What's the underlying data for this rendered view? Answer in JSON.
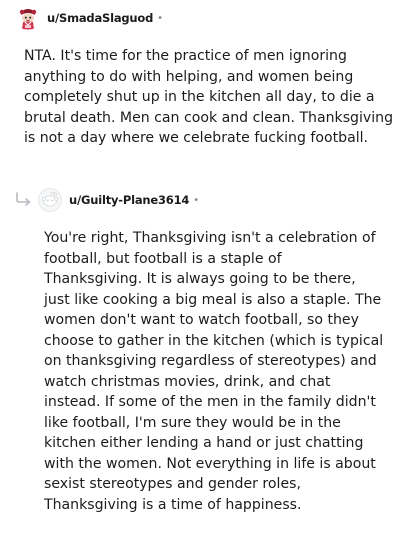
{
  "comments": [
    {
      "username": "u/SmadaSlaguod",
      "avatar_icon": "snoo-avatar-costume-icon",
      "separator": "•",
      "body": "NTA. It's time for the practice of men ignoring anything to do with helping, and women being completely shut up in the kitchen all day, to die a brutal death. Men can cook and clean. Thanksgiving is not a day where we celebrate fucking football."
    },
    {
      "username": "u/Guilty-Plane3614",
      "avatar_icon": "default-avatar-icon",
      "reply_icon": "reply-arrow-icon",
      "separator": "•",
      "body": "You're right, Thanksgiving isn't a celebration of football, but football is a staple of Thanksgiving. It is always going to be there, just like cooking a big meal is also a staple. The women don't want to watch football, so they choose to gather in the kitchen (which is typical on thanksgiving regardless of stereotypes) and watch christmas movies, drink, and chat instead. If some of the men in the family didn't like football, I'm sure they would be in the kitchen either lending a hand or just chatting with the women. Not everything in life is about sexist stereotypes and gender roles, Thanksgiving is a time of happiness."
    }
  ],
  "colors": {
    "text": "#1c1c1c",
    "meta": "#878a8c",
    "reply_arrow": "#b8bcc0"
  }
}
